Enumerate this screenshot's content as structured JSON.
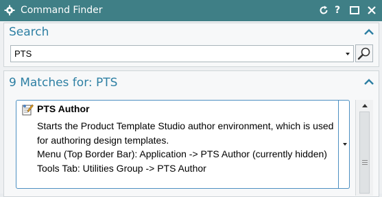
{
  "window": {
    "title": "Command Finder",
    "title_icon": "gear-icon",
    "controls": [
      "refresh-icon",
      "help-icon",
      "maximize-icon",
      "close-icon"
    ],
    "colors": {
      "titlebar": "#3f7f86",
      "section_heading": "#2d7fa3",
      "result_border": "#4c8fc1"
    }
  },
  "search": {
    "heading": "Search",
    "query": "PTS",
    "find_icon": "find-magnifier-icon"
  },
  "matches": {
    "heading": "9 Matches for: PTS",
    "results": [
      {
        "icon": "command-icon",
        "title": "PTS Author",
        "description": "Starts the Product Template Studio author environment, which is used for authoring design templates.",
        "menu_path": "Menu (Top Border Bar): Application -> PTS Author (currently hidden)",
        "tab_path": "Tools Tab: Utilities Group -> PTS Author"
      }
    ]
  }
}
